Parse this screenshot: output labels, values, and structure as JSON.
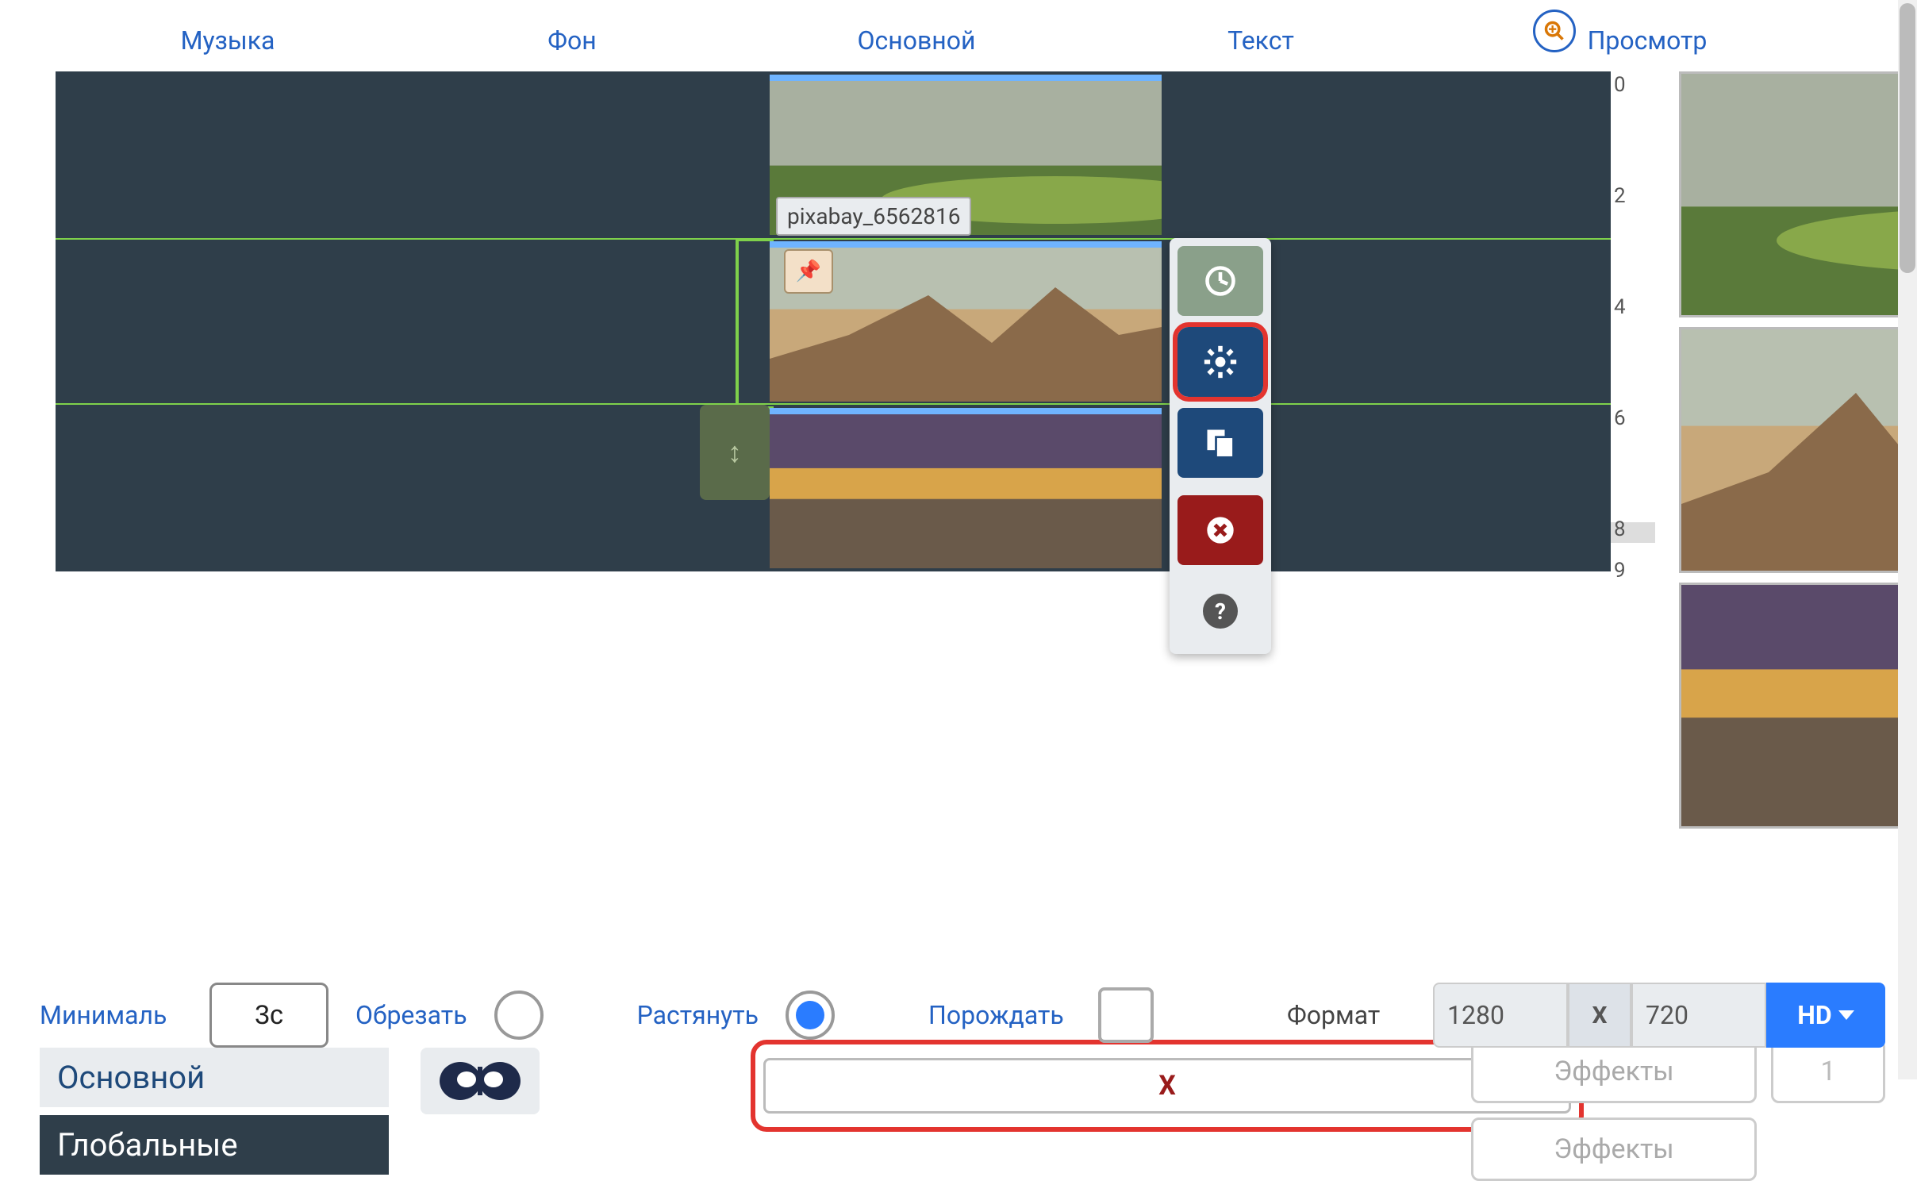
{
  "tabs": {
    "music": "Музыка",
    "background": "Фон",
    "main": "Основной",
    "text": "Текст",
    "preview": "Просмотр"
  },
  "clip_label": "pixabay_6562816",
  "ruler": {
    "marks": [
      "0",
      "2",
      "4",
      "6",
      "8",
      "9"
    ]
  },
  "option_tabs": {
    "main": "Основной",
    "global": "Глобальные"
  },
  "x_bar": "X",
  "effects": {
    "label": "Эффекты",
    "count": "1"
  },
  "bottom": {
    "min_label": "Минималь",
    "min_value": "3с",
    "crop": "Обрезать",
    "stretch": "Растянуть",
    "spawn": "Порождать",
    "format": "Формат",
    "dims": {
      "w": "1280",
      "x": "X",
      "h": "720",
      "hd": "HD"
    }
  },
  "icons": {
    "pin": "📌",
    "drag": "↕",
    "clock": "clock",
    "gear": "gear",
    "copy": "copy",
    "delete": "x-circle",
    "help": "?",
    "zoom": "zoom"
  }
}
